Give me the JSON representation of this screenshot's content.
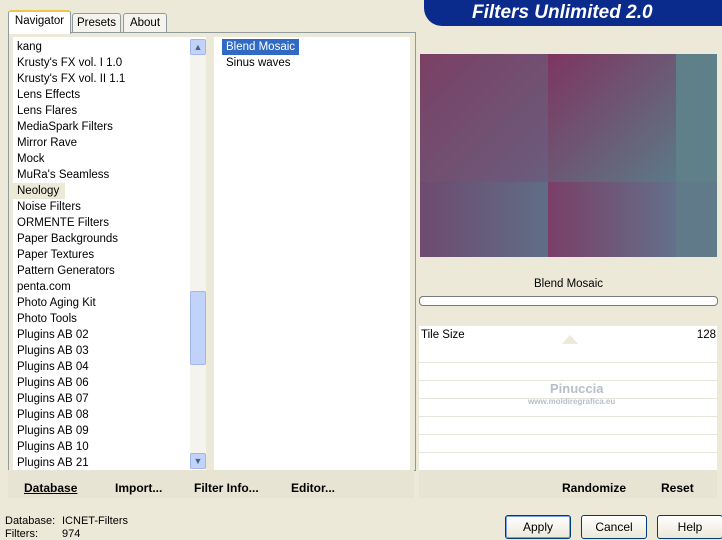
{
  "tabs": [
    "Navigator",
    "Presets",
    "About"
  ],
  "app_title": "Filters Unlimited 2.0",
  "categories": [
    "kang",
    "Krusty's FX vol. I 1.0",
    "Krusty's FX vol. II 1.1",
    "Lens Effects",
    "Lens Flares",
    "MediaSpark Filters",
    "Mirror Rave",
    "Mock",
    "MuRa's Seamless",
    "Neology",
    "Noise Filters",
    "ORMENTE Filters",
    "Paper Backgrounds",
    "Paper Textures",
    "Pattern Generators",
    "penta.com",
    "Photo Aging Kit",
    "Photo Tools",
    "Plugins AB 02",
    "Plugins AB 03",
    "Plugins AB 04",
    "Plugins AB 06",
    "Plugins AB 07",
    "Plugins AB 08",
    "Plugins AB 09",
    "Plugins AB 10",
    "Plugins AB 21"
  ],
  "selected_category": "Neology",
  "filters": [
    "Blend Mosaic",
    "Sinus waves"
  ],
  "selected_filter": "Blend Mosaic",
  "filter_name": "Blend Mosaic",
  "param": {
    "label": "Tile Size",
    "value": "128"
  },
  "watermark": {
    "line1": "Pinuccia",
    "line2": "www.moldiregrafica.eu"
  },
  "toolbar": {
    "database": "Database",
    "import": "Import...",
    "filter_info": "Filter Info...",
    "editor": "Editor...",
    "randomize": "Randomize",
    "reset": "Reset"
  },
  "status": {
    "database_label": "Database:",
    "database_value": "ICNET-Filters",
    "filters_label": "Filters:",
    "filters_value": "974"
  },
  "buttons": {
    "apply": "Apply",
    "cancel": "Cancel",
    "help": "Help"
  },
  "colors": {
    "selection": "#316ac5",
    "title_bar": "#0a2a8c"
  }
}
